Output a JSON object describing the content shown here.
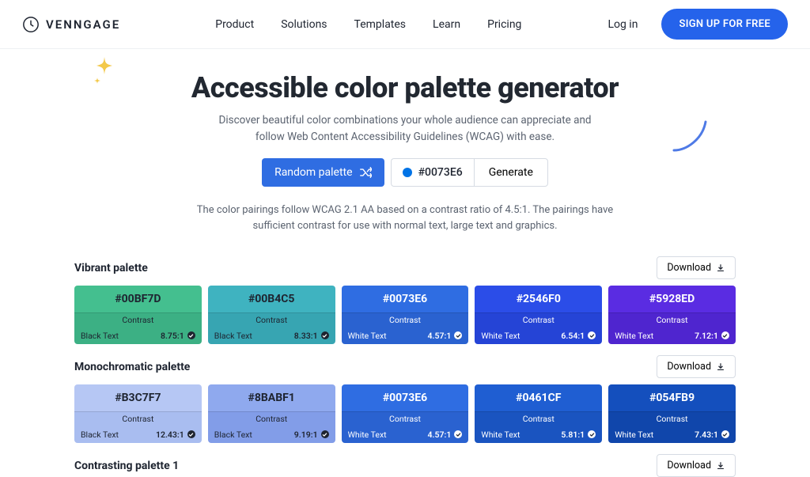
{
  "brand": "VENNGAGE",
  "nav": [
    "Product",
    "Solutions",
    "Templates",
    "Learn",
    "Pricing"
  ],
  "login": "Log in",
  "cta": "SIGN UP FOR FREE",
  "title": "Accessible color palette generator",
  "subtitle1": "Discover beautiful color combinations your whole audience can appreciate and",
  "subtitle2": "follow Web Content Accessibility Guidelines (WCAG) with ease.",
  "random": "Random palette",
  "hex": "#0073E6",
  "swatch": "#0073E6",
  "generate": "Generate",
  "note1": "The color pairings follow WCAG 2.1 AA based on a contrast ratio of 4.5:1. The pairings have",
  "note2": "sufficient contrast for use with normal text, large text and graphics.",
  "download": "Download",
  "contrastLabel": "Contrast",
  "textLabel": {
    "dark": "Black Text",
    "light": "White Text"
  },
  "palettes": [
    {
      "name": "Vibrant palette",
      "swatches": [
        {
          "hex": "#00BF7D",
          "bg": "#44bf8f",
          "panel": "#3cb084",
          "mode": "dark",
          "ratio": "8.75:1"
        },
        {
          "hex": "#00B4C5",
          "bg": "#3fb3c0",
          "panel": "#37a5b2",
          "mode": "dark",
          "ratio": "8.33:1"
        },
        {
          "hex": "#0073E6",
          "bg": "#2f6de2",
          "panel": "#2a62d0",
          "mode": "light",
          "ratio": "4.57:1"
        },
        {
          "hex": "#2546F0",
          "bg": "#2b4de8",
          "panel": "#2544d6",
          "mode": "light",
          "ratio": "6.54:1"
        },
        {
          "hex": "#5928ED",
          "bg": "#5a2ce2",
          "panel": "#4f25cf",
          "mode": "light",
          "ratio": "7.12:1"
        }
      ]
    },
    {
      "name": "Monochromatic palette",
      "swatches": [
        {
          "hex": "#B3C7F7",
          "bg": "#b6c7f4",
          "panel": "#a9bdf0",
          "mode": "dark",
          "ratio": "12.43:1"
        },
        {
          "hex": "#8BABF1",
          "bg": "#8fa9ee",
          "panel": "#829de8",
          "mode": "dark",
          "ratio": "9.19:1"
        },
        {
          "hex": "#0073E6",
          "bg": "#2f6de2",
          "panel": "#2a62d0",
          "mode": "light",
          "ratio": "4.57:1"
        },
        {
          "hex": "#0461CF",
          "bg": "#1f5ed2",
          "panel": "#1a54c0",
          "mode": "light",
          "ratio": "5.81:1"
        },
        {
          "hex": "#054FB9",
          "bg": "#144fbd",
          "panel": "#1046ab",
          "mode": "light",
          "ratio": "7.43:1"
        }
      ]
    },
    {
      "name": "Contrasting palette 1",
      "swatches": []
    }
  ]
}
